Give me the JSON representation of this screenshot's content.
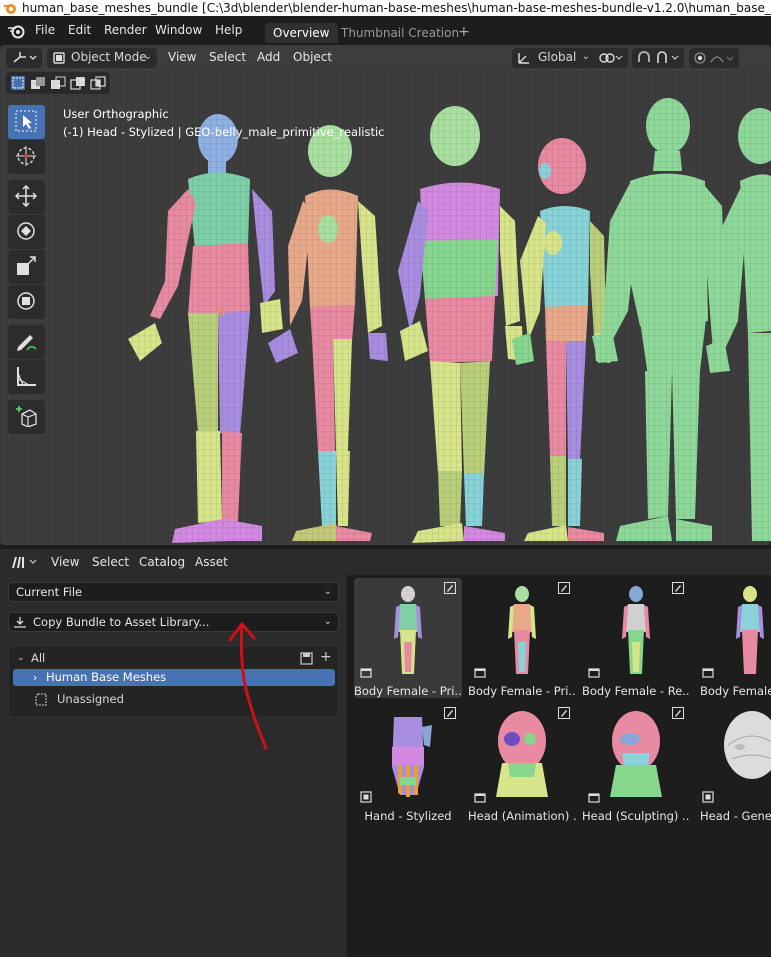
{
  "window": {
    "title": "human_base_meshes_bundle [C:\\3d\\blender\\blender-human-base-meshes\\human-base-meshes-bundle-v1.2.0\\human_base_meshes_bundle.blend]"
  },
  "topbar": {
    "menus": [
      "File",
      "Edit",
      "Render",
      "Window",
      "Help"
    ],
    "workspace_tabs": [
      "Overview",
      "Thumbnail Creation"
    ],
    "active_tab": "Overview"
  },
  "viewport": {
    "mode": "Object Mode",
    "menus": [
      "View",
      "Select",
      "Add",
      "Object"
    ],
    "transform_orientation": "Global",
    "info_line1": "User Orthographic",
    "info_line2": "(-1) Head - Stylized | GEO-belly_male_primitive_realistic",
    "tools": [
      "select-box",
      "cursor",
      "move",
      "rotate",
      "scale",
      "transform",
      "annotate",
      "measure",
      "add-cube"
    ],
    "active_tool": "select-box"
  },
  "asset_browser": {
    "menus": [
      "View",
      "Select",
      "Catalog",
      "Asset"
    ],
    "library": "Current File",
    "import_action": "Copy Bundle to Asset Library...",
    "catalog_root": "All",
    "catalogs": [
      "Human Base Meshes",
      "Unassigned"
    ],
    "selected_catalog": "Human Base Meshes",
    "assets": [
      {
        "name": "Body Female - Pri..."
      },
      {
        "name": "Body Female - Pri..."
      },
      {
        "name": "Body Female - Re..."
      },
      {
        "name": "Body Female"
      },
      {
        "name": "Hand - Stylized"
      },
      {
        "name": "Head (Animation) ..."
      },
      {
        "name": "Head (Sculpting) ..."
      },
      {
        "name": "Head - Generic"
      }
    ]
  },
  "colors": {
    "accent": "#4772b3",
    "viewport_bg": "#3d3d3d",
    "annotation": "#d01018"
  }
}
